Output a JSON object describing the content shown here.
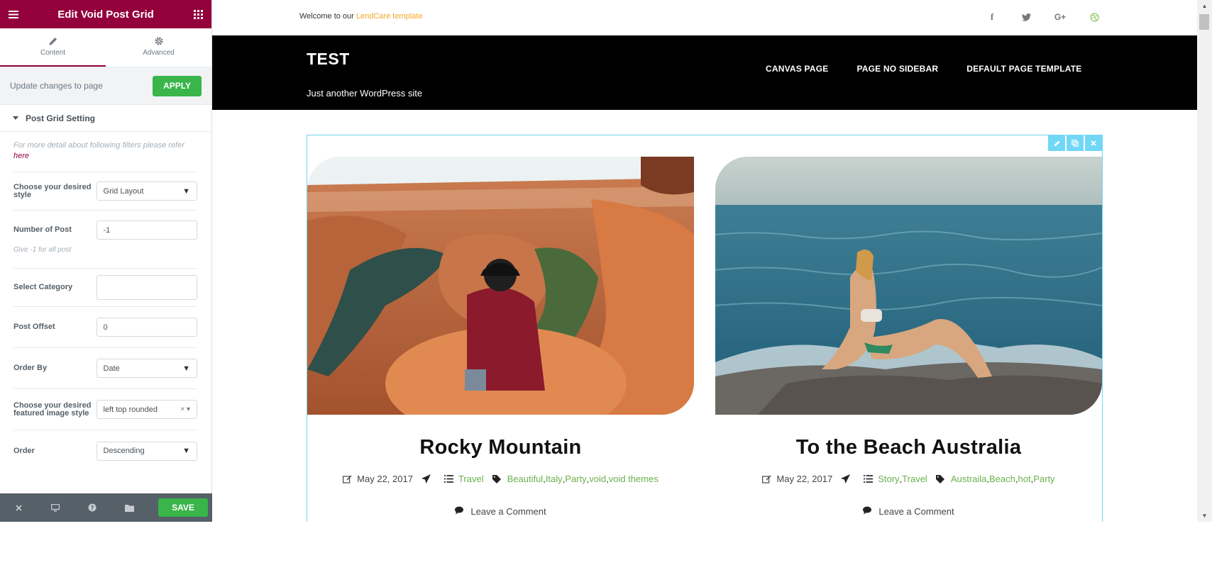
{
  "panel": {
    "title": "Edit Void Post Grid",
    "tabs": [
      {
        "label": "Content",
        "icon": "pencil-icon"
      },
      {
        "label": "Advanced",
        "icon": "gear-icon"
      }
    ],
    "update_text": "Update changes to page",
    "apply_label": "APPLY",
    "section_title": "Post Grid Setting",
    "note_text": "For more detail about following filters please refer",
    "note_link": "here",
    "controls": {
      "style": {
        "label": "Choose your desired style",
        "value": "Grid Layout"
      },
      "num_posts": {
        "label": "Number of Post",
        "value": "-1",
        "hint": "Give -1 for all post"
      },
      "category": {
        "label": "Select Category",
        "value": ""
      },
      "offset": {
        "label": "Post Offset",
        "value": "0"
      },
      "order_by": {
        "label": "Order By",
        "value": "Date"
      },
      "image_style": {
        "label": "Choose your desired featured image style",
        "value": "left top rounded"
      },
      "order": {
        "label": "Order",
        "value": "Descending"
      }
    },
    "footer": {
      "save_label": "SAVE"
    }
  },
  "site": {
    "welcome_prefix": "Welcome to our ",
    "welcome_accent": "LendCare template",
    "social": [
      "f",
      "t",
      "G+",
      "dribbble"
    ],
    "title": "TEST",
    "tagline": "Just another WordPress site",
    "nav": [
      "CANVAS PAGE",
      "PAGE NO SIDEBAR",
      "DEFAULT PAGE TEMPLATE"
    ]
  },
  "posts": [
    {
      "title": "Rocky Mountain",
      "date": "May 22, 2017",
      "categories": [
        "Travel"
      ],
      "tags": [
        "Beautiful",
        "Italy",
        "Party",
        "void",
        "void themes"
      ],
      "comment": "Leave a Comment"
    },
    {
      "title": "To the Beach Australia",
      "date": "May 22, 2017",
      "categories": [
        "Story",
        "Travel"
      ],
      "tags": [
        "Austraila",
        "Beach",
        "hot",
        "Party"
      ],
      "comment": "Leave a Comment"
    }
  ],
  "colors": {
    "brand": "#93003c",
    "apply_green": "#39b54a",
    "accent_orange": "#f5a623",
    "widget_border": "#71d7f7",
    "link_green": "#6ab04c"
  }
}
